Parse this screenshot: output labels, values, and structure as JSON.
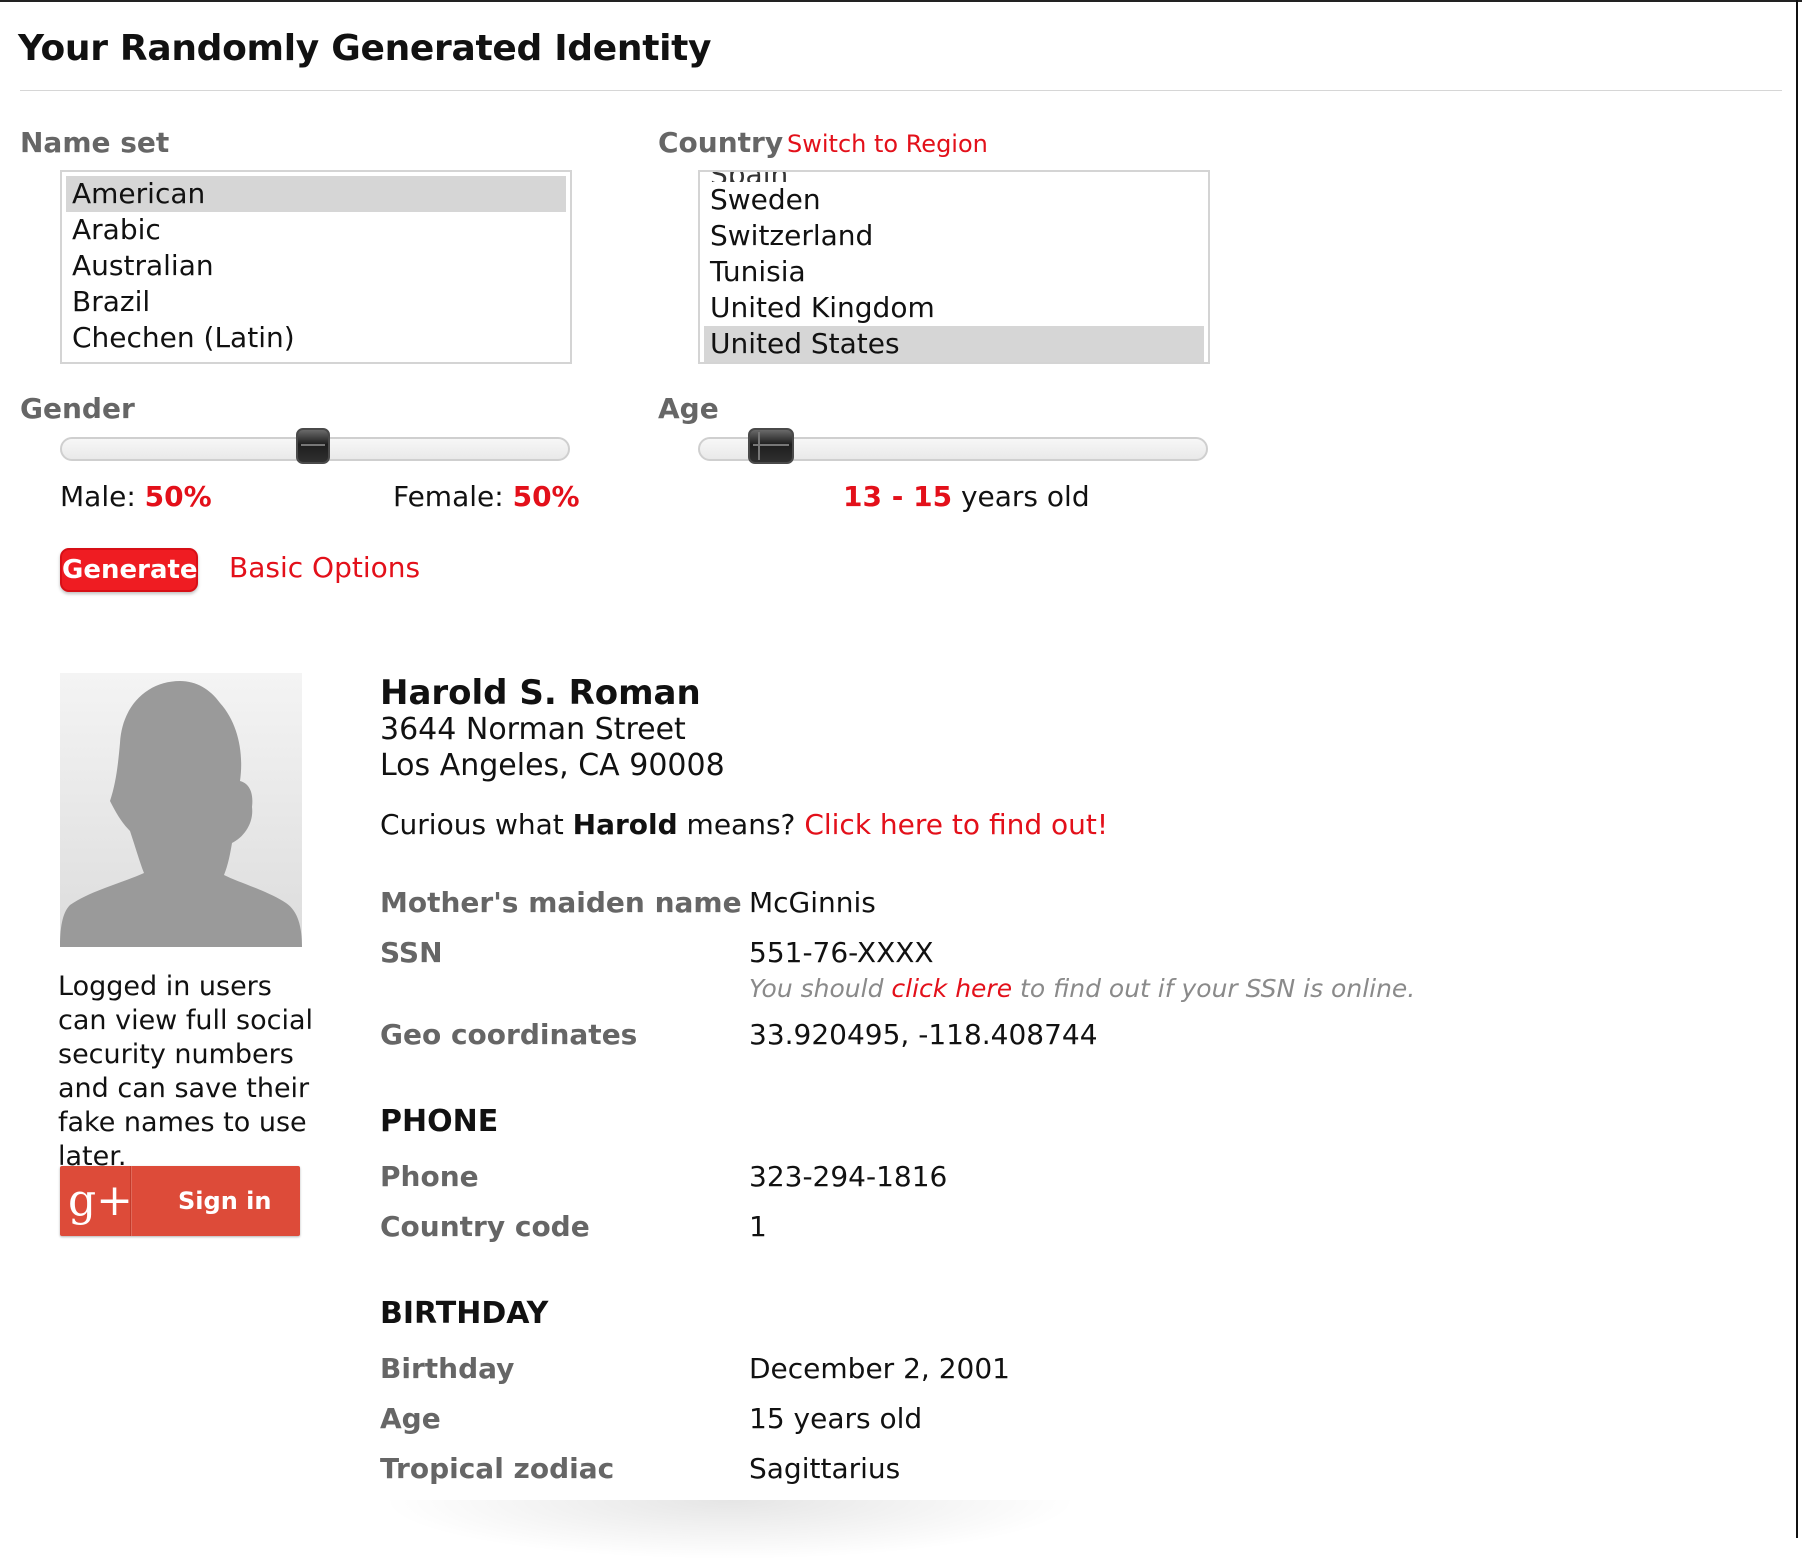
{
  "page": {
    "title": "Your Randomly Generated Identity"
  },
  "name_set": {
    "label": "Name set",
    "options": [
      "American",
      "Arabic",
      "Australian",
      "Brazil",
      "Chechen (Latin)"
    ],
    "selected": "American"
  },
  "country": {
    "label": "Country",
    "switch_link": "Switch to Region",
    "partial_above": "Spain",
    "options": [
      "Sweden",
      "Switzerland",
      "Tunisia",
      "United Kingdom",
      "United States"
    ],
    "selected": "United States"
  },
  "gender": {
    "label": "Gender",
    "male_label": "Male:",
    "male_value": "50%",
    "female_label": "Female:",
    "female_value": "50%",
    "slider_male_fraction": 0.5
  },
  "age": {
    "label": "Age",
    "range_min": "13",
    "range_sep": " - ",
    "range_max": "15",
    "range_suffix": " years old"
  },
  "actions": {
    "generate": "Generate",
    "basic_options": "Basic Options"
  },
  "sidebar": {
    "login_note": "Logged in users can view full social security numbers and can save their fake names to use later.",
    "signin": "Sign in",
    "gplus_glyph": "g+"
  },
  "identity": {
    "name": "Harold S. Roman",
    "street": "3644 Norman Street",
    "city_line": "Los Angeles, CA 90008",
    "curious_prefix": "Curious what ",
    "first_name": "Harold",
    "curious_suffix": " means? ",
    "curious_link": "Click here to find out!"
  },
  "details": {
    "mmn_label": "Mother's maiden name",
    "mmn_value": "McGinnis",
    "ssn_label": "SSN",
    "ssn_value": "551-76-XXXX",
    "ssn_note_prefix": "You should ",
    "ssn_note_link": "click here",
    "ssn_note_suffix": " to find out if your SSN is online.",
    "geo_label": "Geo coordinates",
    "geo_value": "33.920495, -118.408744"
  },
  "phone": {
    "heading": "PHONE",
    "phone_label": "Phone",
    "phone_value": "323-294-1816",
    "cc_label": "Country code",
    "cc_value": "1"
  },
  "birthday": {
    "heading": "BIRTHDAY",
    "birthday_label": "Birthday",
    "birthday_value": "December 2, 2001",
    "age_label": "Age",
    "age_value": "15 years old",
    "zodiac_label": "Tropical zodiac",
    "zodiac_value": "Sagittarius"
  },
  "colors": {
    "accent": "#e3101a",
    "label_gray": "#666666",
    "selected_bg": "#d6d6d6",
    "gplus": "#dd4b39"
  }
}
